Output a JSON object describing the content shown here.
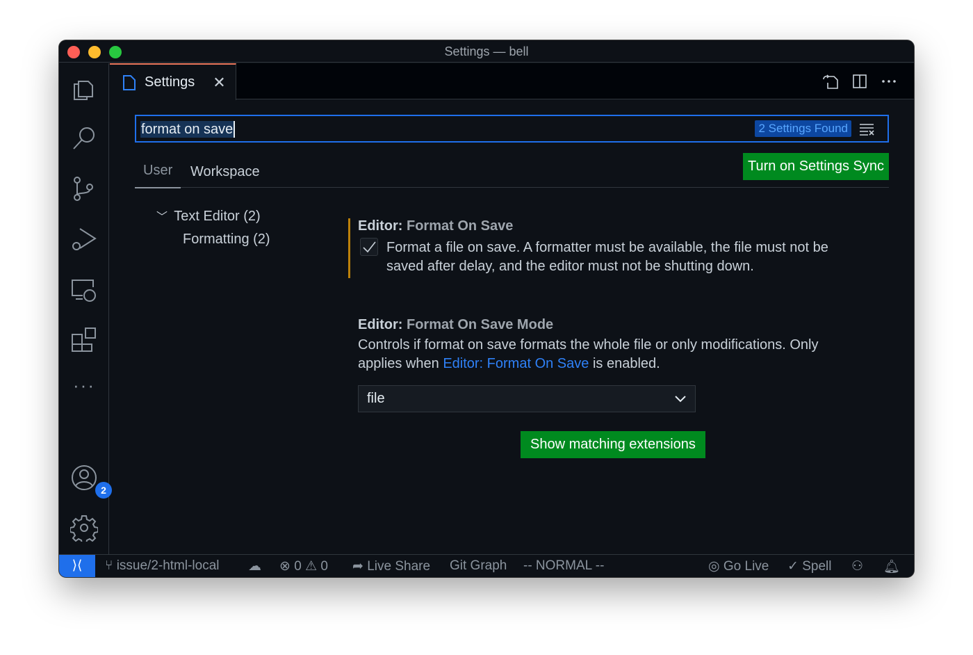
{
  "window": {
    "title": "Settings — bell"
  },
  "colors": {
    "accent": "#1f6feb",
    "button": "#008a1f",
    "modified": "#bb800a",
    "background": "#0d1117"
  },
  "activity": {
    "icons": [
      "files-icon",
      "search-icon",
      "source-control-icon",
      "run-debug-icon",
      "remote-explorer-icon",
      "extensions-icon",
      "more-icon",
      "accounts-icon",
      "gear-icon"
    ],
    "accounts_badge": "2",
    "more": "···"
  },
  "tab": {
    "label": "Settings",
    "close": "✕"
  },
  "search": {
    "value": "format on save",
    "results": "2 Settings Found"
  },
  "scope_tabs": [
    {
      "label": "User",
      "active": true
    },
    {
      "label": "Workspace",
      "active": false
    }
  ],
  "sync_button": "Turn on Settings Sync",
  "tree": {
    "group": "Text Editor (2)",
    "child": "Formatting (2)"
  },
  "settings": [
    {
      "category": "Editor: ",
      "name": "Format On Save",
      "checked": true,
      "desc_line1": "Format a file on save. A formatter must be available, the file must not be",
      "desc_line2": "saved after delay, and the editor must not be shutting down."
    },
    {
      "category": "Editor: ",
      "name": "Format On Save Mode",
      "desc_line1": "Controls if format on save formats the whole file or only modifications. Only",
      "desc_pre": "applies when ",
      "desc_link": "Editor: Format On Save",
      "desc_post": " is enabled.",
      "value": "file"
    }
  ],
  "show_extensions": "Show matching extensions",
  "statusbar": {
    "branch": "issue/2-html-local",
    "errors": "0",
    "warnings": "0",
    "live_share": "Live Share",
    "git_graph": "Git Graph",
    "mode": "-- NORMAL --",
    "go_live": "Go Live",
    "spell": "Spell"
  }
}
